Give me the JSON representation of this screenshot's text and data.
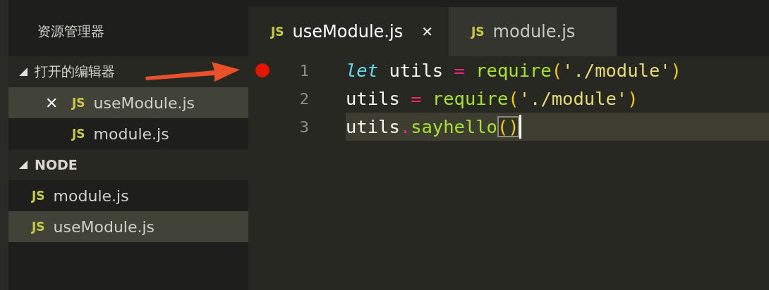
{
  "sidebar": {
    "title": "资源管理器",
    "sections": [
      {
        "title": "打开的编辑器",
        "expanded": true,
        "items": [
          {
            "label": "useModule.js",
            "badge": "JS",
            "selected": true,
            "close": "✕"
          },
          {
            "label": "module.js",
            "badge": "JS",
            "selected": false
          }
        ]
      },
      {
        "title": "NODE",
        "expanded": true,
        "items": [
          {
            "label": "module.js",
            "badge": "JS",
            "selected": false
          },
          {
            "label": "useModule.js",
            "badge": "JS",
            "selected": true
          }
        ]
      }
    ]
  },
  "tabs": [
    {
      "label": "useModule.js",
      "badge": "JS",
      "selected": true,
      "close": "✕"
    },
    {
      "label": "module.js",
      "badge": "JS",
      "selected": false
    }
  ],
  "editor": {
    "lines": [
      {
        "number": "1",
        "breakpoint": true,
        "current": false,
        "cursor": false,
        "tokens": [
          {
            "kind": "keyword",
            "text": "let"
          },
          {
            "kind": "plain",
            "text": " utils "
          },
          {
            "kind": "operator",
            "text": "= "
          },
          {
            "kind": "function",
            "text": "require"
          },
          {
            "kind": "paren",
            "text": "("
          },
          {
            "kind": "string",
            "text": "'./module'"
          },
          {
            "kind": "paren",
            "text": ")"
          }
        ]
      },
      {
        "number": "2",
        "breakpoint": false,
        "current": false,
        "cursor": false,
        "tokens": [
          {
            "kind": "plain",
            "text": "utils "
          },
          {
            "kind": "operator",
            "text": "= "
          },
          {
            "kind": "function",
            "text": "require"
          },
          {
            "kind": "paren",
            "text": "("
          },
          {
            "kind": "string",
            "text": "'./module'"
          },
          {
            "kind": "paren",
            "text": ")"
          }
        ]
      },
      {
        "number": "3",
        "breakpoint": false,
        "current": true,
        "cursor": true,
        "tokens": [
          {
            "kind": "plain",
            "text": "utils"
          },
          {
            "kind": "operator",
            "text": "."
          },
          {
            "kind": "function",
            "text": "sayhello"
          },
          {
            "kind": "bracket-match",
            "text": "()"
          }
        ]
      }
    ]
  },
  "annotation": {
    "kind": "arrow"
  }
}
